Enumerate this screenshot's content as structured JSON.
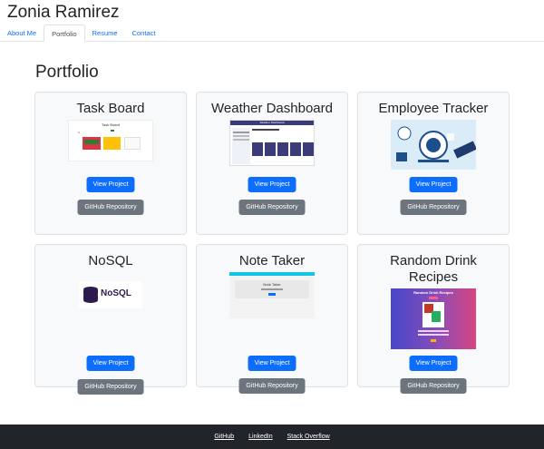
{
  "header": {
    "site_name": "Zonia Ramirez",
    "nav": [
      {
        "label": "About Me"
      },
      {
        "label": "Portfolio"
      },
      {
        "label": "Resume"
      },
      {
        "label": "Contact"
      }
    ]
  },
  "portfolio": {
    "title": "Portfolio",
    "projects": [
      {
        "title": "Task Board",
        "view_label": "View Project",
        "repo_label": "GitHub Repository",
        "thumb_text": "Task Board"
      },
      {
        "title": "Weather Dashboard",
        "view_label": "View Project",
        "repo_label": "GitHub Repository",
        "thumb_text": "Weather Dashboard"
      },
      {
        "title": "Employee Tracker",
        "view_label": "View Project",
        "repo_label": "GitHub Repository"
      },
      {
        "title": "NoSQL",
        "view_label": "View Project",
        "repo_label": "GitHub Repository",
        "thumb_text": "NoSQL"
      },
      {
        "title": "Note Taker",
        "view_label": "View Project",
        "repo_label": "GitHub Repository",
        "thumb_text": "Note Taker"
      },
      {
        "title": "Random Drink Recipes",
        "view_label": "View Project",
        "repo_label": "GitHub Repository",
        "thumb_text": "Random Drink Recipes"
      }
    ]
  },
  "footer": {
    "links": [
      {
        "label": "GitHub"
      },
      {
        "label": "LinkedIn"
      },
      {
        "label": "Stack Overflow"
      }
    ]
  }
}
